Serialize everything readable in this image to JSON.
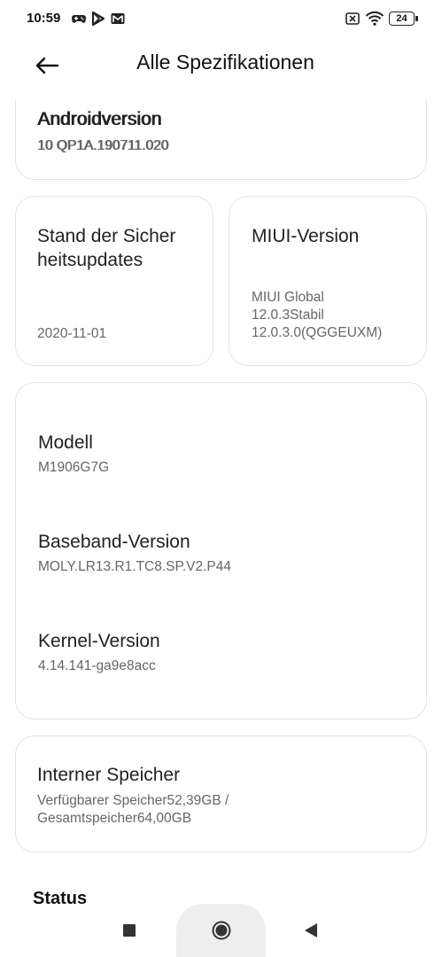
{
  "status_bar": {
    "time": "10:59",
    "battery_level": "24",
    "left_icons": [
      "game-controller-icon",
      "play-store-icon",
      "gmail-icon"
    ],
    "right_icons": [
      "no-sim-icon",
      "wifi-icon",
      "battery-icon"
    ]
  },
  "header": {
    "title": "Alle Spezifikationen",
    "back_icon": "arrow-left-icon"
  },
  "cards": {
    "android": {
      "label": "Androidversion",
      "value": "10 QP1A.190711.020"
    },
    "security": {
      "label_line1": "Stand der Sicher",
      "label_line2": "heitsupdates",
      "value": "2020-11-01"
    },
    "miui": {
      "label": "MIUI-Version",
      "value_line1": "MIUI Global",
      "value_line2": "12.0.3Stabil",
      "value_line3": "12.0.3.0(QGGEUXM)"
    },
    "model": {
      "label": "Modell",
      "value": "M1906G7G"
    },
    "baseband": {
      "label": "Baseband-Version",
      "value": "MOLY.LR13.R1.TC8.SP.V2.P44"
    },
    "kernel": {
      "label": "Kernel-Version",
      "value": "4.14.141-ga9e8acc"
    },
    "storage": {
      "label": "Interner Speicher",
      "value_line1": "Verfügbarer Speicher52,39GB /",
      "value_line2": "Gesamtspeicher64,00GB"
    }
  },
  "status_section": {
    "heading": "Status"
  },
  "nav_bar": {
    "buttons": [
      "recents-square-icon",
      "home-circle-icon",
      "back-triangle-icon"
    ]
  }
}
